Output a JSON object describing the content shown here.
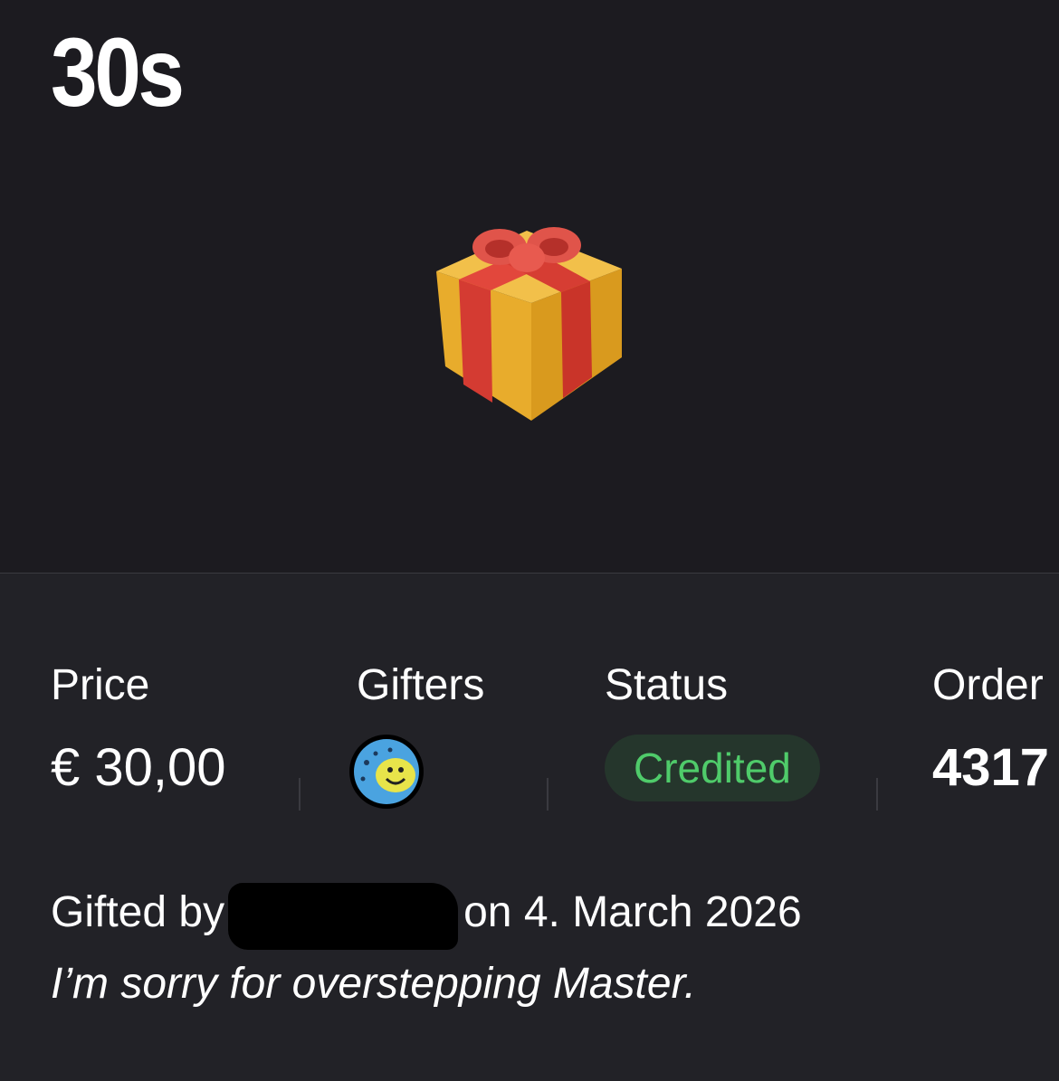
{
  "header": {
    "title": "30s"
  },
  "hero": {
    "gift_icon": "wrapped-gift-icon"
  },
  "details": {
    "price": {
      "label": "Price",
      "value": "€ 30,00"
    },
    "gifters": {
      "label": "Gifters",
      "avatar_icon": "smiley-avatar-icon"
    },
    "status": {
      "label": "Status",
      "value": "Credited",
      "color": "#4fcb6a",
      "bg_color": "#25362c"
    },
    "order": {
      "label": "Order",
      "value": "4317"
    }
  },
  "gift_info": {
    "prefix": "Gifted by",
    "suffix": "on 4. March 2026",
    "message": "I’m sorry for overstepping Master."
  },
  "colors": {
    "background": "#1c1b20",
    "panel": "#222227",
    "text": "#ffffff",
    "accent_green": "#4fcb6a"
  }
}
